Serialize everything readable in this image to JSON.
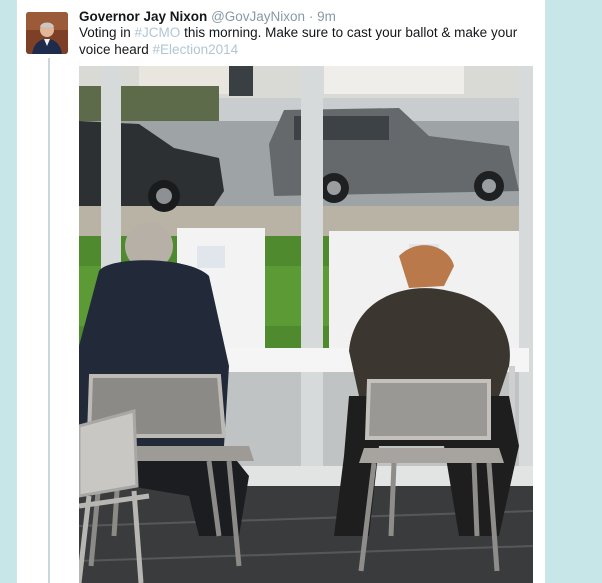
{
  "tweet": {
    "author_name": "Governor Jay Nixon",
    "handle": "@GovJayNixon",
    "separator": "·",
    "time": "9m",
    "text_parts": [
      {
        "text": "Voting in ",
        "type": "text"
      },
      {
        "text": "#JCMO",
        "type": "hashtag"
      },
      {
        "text": " this morning. Make sure to cast your ballot & make your voice heard ",
        "type": "text"
      },
      {
        "text": "#Election2014",
        "type": "hashtag"
      }
    ]
  },
  "media": {
    "description_icon": "photo"
  },
  "colors": {
    "page_background": "#c7e6e7",
    "name": "#14171a",
    "meta": "#8899a6",
    "hashtag": "#b1c6d4"
  }
}
